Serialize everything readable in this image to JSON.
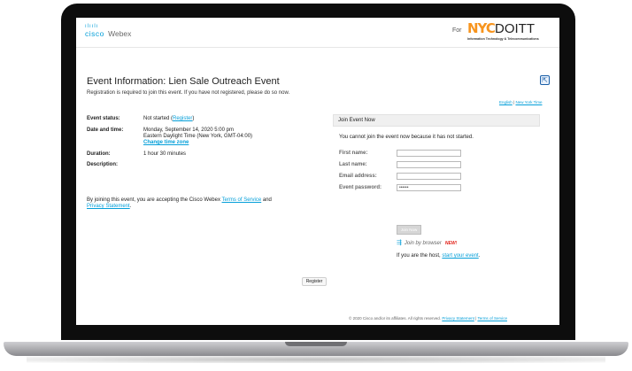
{
  "header": {
    "brand": "cisco",
    "product": "Webex",
    "for_label": "For",
    "partner_logo_primary": "NYC",
    "partner_logo_secondary": "DOITT",
    "partner_logo_subtitle": "Information Technology & Telecommunications"
  },
  "event": {
    "title": "Event Information: Lien Sale Outreach Event",
    "registration_note": "Registration is required to join this event. If you have not registered, please do so now.",
    "share_icon": "share-icon",
    "language_link": "English",
    "timezone_link": "New York Time"
  },
  "details": {
    "status_label": "Event status:",
    "status_value": "Not started (",
    "status_register_link": "Register",
    "status_close": ")",
    "datetime_label": "Date and time:",
    "datetime_line1": "Monday, September 14, 2020 5:00 pm",
    "datetime_line2": "Eastern Daylight Time (New York, GMT-04:00)",
    "change_timezone": "Change time zone",
    "duration_label": "Duration:",
    "duration_value": "1 hour 30 minutes",
    "description_label": "Description:"
  },
  "terms": {
    "prefix": "By joining this event, you are accepting the Cisco Webex ",
    "terms_link": "Terms of Service",
    "middle": " and ",
    "privacy_link": "Privacy Statement",
    "suffix": "."
  },
  "join": {
    "header": "Join Event Now",
    "message": "You cannot join the event now because it has not started.",
    "fields": [
      {
        "label": "First name:",
        "value": "",
        "placeholder": ""
      },
      {
        "label": "Last name:",
        "value": "",
        "placeholder": ""
      },
      {
        "label": "Email address:",
        "value": "",
        "placeholder": ""
      },
      {
        "label": "Event password:",
        "value": "••••••",
        "placeholder": ""
      }
    ],
    "join_button": "Join Now",
    "browser_label": "Join by browser",
    "new_badge": "NEW!",
    "host_prefix": "If you are the host, ",
    "host_link": "start your event",
    "host_suffix": "."
  },
  "register_button": "Register",
  "footer": {
    "copyright": "© 2020 Cisco and/or its affiliates. All rights reserved.",
    "privacy_link": "Privacy Statement",
    "separator": "|",
    "terms_link": "Terms of Service"
  },
  "colors": {
    "link": "#049fd9",
    "nyc_orange": "#f7941d",
    "new_red": "#e2231a"
  }
}
